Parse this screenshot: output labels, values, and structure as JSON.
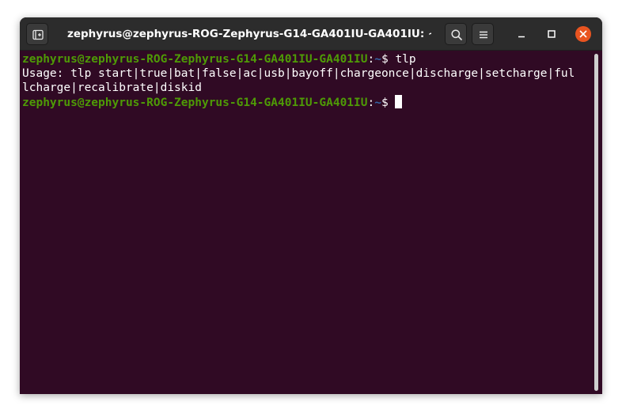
{
  "window": {
    "title": "zephyrus@zephyrus-ROG-Zephyrus-G14-GA401IU-GA401IU: ~"
  },
  "colors": {
    "terminal_bg": "#300a24",
    "prompt_user": "#4e9a06",
    "prompt_path": "#3465a4",
    "titlebar_bg": "#2c2c2c",
    "close_button": "#e95420"
  },
  "icons": {
    "new_tab": "new-tab-icon",
    "search": "search-icon",
    "menu": "hamburger-menu-icon",
    "minimize": "minimize-icon",
    "maximize": "maximize-icon",
    "close": "close-icon"
  },
  "terminal": {
    "lines": [
      {
        "user": "zephyrus@zephyrus-ROG-Zephyrus-G14-GA401IU-GA401IU",
        "sep": ":",
        "path": "~",
        "prompt": "$ ",
        "command": "tlp"
      },
      {
        "text": "Usage: tlp start|true|bat|false|ac|usb|bayoff|chargeonce|discharge|setcharge|ful"
      },
      {
        "text": "lcharge|recalibrate|diskid"
      },
      {
        "user": "zephyrus@zephyrus-ROG-Zephyrus-G14-GA401IU-GA401IU",
        "sep": ":",
        "path": "~",
        "prompt": "$ ",
        "command": ""
      }
    ]
  }
}
